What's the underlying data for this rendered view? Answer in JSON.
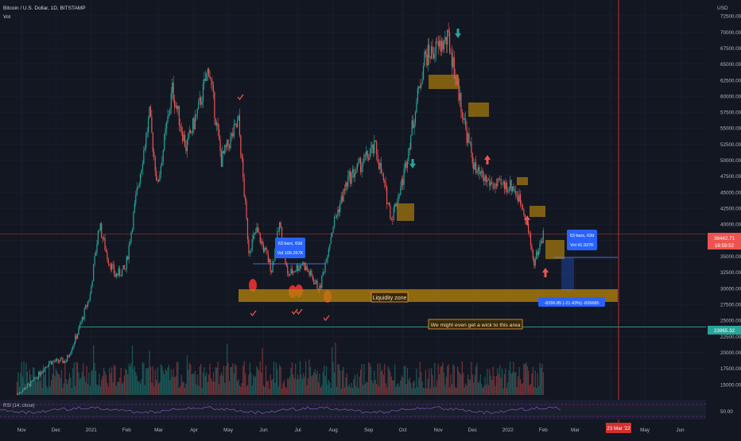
{
  "header": {
    "symbol": "Bitcoin / U.S. Dollar, 1D, BITSTAMP",
    "vol_label": "Vol",
    "currency": "USD"
  },
  "price_axis": {
    "ticks": [
      72500,
      70000,
      67500,
      65000,
      62500,
      60000,
      57500,
      55000,
      52500,
      50000,
      47500,
      45000,
      42500,
      40000,
      37500,
      35000,
      32500,
      30000,
      27500,
      25000,
      22500,
      20000,
      17500,
      15000
    ],
    "tick_labels": [
      "72500.00",
      "70000.00",
      "67500.00",
      "65000.00",
      "62500.00",
      "60000.00",
      "57500.00",
      "55000.00",
      "52500.00",
      "50000.00",
      "47500.00",
      "45000.00",
      "42500.00",
      "40000.00",
      "37500.00",
      "35000.00",
      "32500.00",
      "30000.00",
      "27500.00",
      "25000.00",
      "22500.00",
      "20000.00",
      "17500.00",
      "15000.00"
    ],
    "current_price": "38442.71",
    "countdown": "18:59:52",
    "level_label": "23965.32",
    "rsi_level": "50.00"
  },
  "time_axis": {
    "labels": [
      "Nov",
      "Dec",
      "2021",
      "Feb",
      "Mar",
      "Apr",
      "May",
      "Jun",
      "Jul",
      "Aug",
      "Sep",
      "Oct",
      "Nov",
      "Dec",
      "2022",
      "Feb",
      "Mar",
      "Apr",
      "May",
      "Jun"
    ],
    "marker_label": "23 Mar '22"
  },
  "annotations": {
    "liquidity_zone": "Liquidity zone",
    "wick_note": "We might even get a wick to this area",
    "measure1_bars": "63 bars, 63d",
    "measure1_vol": "Vol 109.267K",
    "measure2_bars": "63 bars, 63d",
    "measure2_vol": "Vol 41.937K",
    "drop_label": "-8296.85 (-21.43%) -826685"
  },
  "rsi_label": "RSI (14, close)",
  "colors": {
    "background": "#131722",
    "up": "#26a69a",
    "down": "#ef5350",
    "zone": "#b8860b",
    "level": "#26a69a",
    "measure": "#2962ff",
    "marker": "#d32f2f",
    "rsi": "#9c27b0",
    "grid": "#1e2230"
  },
  "chart_data": {
    "type": "candlestick",
    "title": "Bitcoin / U.S. Dollar, 1D, BITSTAMP",
    "y_range": [
      13000,
      74000
    ],
    "scale": "linear",
    "grid": true,
    "x": [
      "2020-11",
      "2020-12",
      "2021-01",
      "2021-02",
      "2021-03",
      "2021-04",
      "2021-05",
      "2021-06",
      "2021-07",
      "2021-08",
      "2021-09",
      "2021-10",
      "2021-11",
      "2021-12",
      "2022-01",
      "2022-02"
    ],
    "series": [
      {
        "values": [
          13800,
          19000,
          33000,
          45000,
          57000,
          59000,
          37000,
          35000,
          34000,
          46000,
          44000,
          61000,
          57000,
          47000,
          38000,
          38442
        ]
      }
    ],
    "path_points": [
      [
        "2020-10-28",
        13500
      ],
      [
        "2020-11-10",
        15300
      ],
      [
        "2020-11-25",
        18500
      ],
      [
        "2020-12-10",
        18700
      ],
      [
        "2020-12-20",
        23000
      ],
      [
        "2020-12-31",
        29000
      ],
      [
        "2021-01-08",
        40000
      ],
      [
        "2021-01-15",
        35000
      ],
      [
        "2021-01-22",
        32000
      ],
      [
        "2021-01-31",
        33000
      ],
      [
        "2021-02-10",
        45000
      ],
      [
        "2021-02-21",
        57000
      ],
      [
        "2021-02-28",
        46000
      ],
      [
        "2021-03-13",
        61000
      ],
      [
        "2021-03-25",
        52000
      ],
      [
        "2021-04-05",
        58000
      ],
      [
        "2021-04-14",
        64500
      ],
      [
        "2021-04-25",
        50000
      ],
      [
        "2021-05-10",
        56000
      ],
      [
        "2021-05-19",
        36000
      ],
      [
        "2021-05-26",
        39000
      ],
      [
        "2021-06-08",
        33000
      ],
      [
        "2021-06-15",
        40000
      ],
      [
        "2021-06-22",
        32000
      ],
      [
        "2021-07-05",
        34000
      ],
      [
        "2021-07-20",
        29800
      ],
      [
        "2021-08-01",
        40000
      ],
      [
        "2021-08-14",
        47000
      ],
      [
        "2021-09-07",
        52000
      ],
      [
        "2021-09-21",
        41000
      ],
      [
        "2021-10-01",
        47000
      ],
      [
        "2021-10-20",
        66000
      ],
      [
        "2021-11-10",
        68800
      ],
      [
        "2021-11-26",
        54000
      ],
      [
        "2021-12-04",
        48000
      ],
      [
        "2021-12-20",
        46000
      ],
      [
        "2022-01-05",
        46000
      ],
      [
        "2022-01-15",
        42500
      ],
      [
        "2022-01-24",
        34000
      ],
      [
        "2022-02-01",
        38442
      ]
    ],
    "horizontal_levels": [
      {
        "name": "support",
        "value": 23965.32
      },
      {
        "name": "current",
        "value": 38442.71
      }
    ],
    "zones": [
      {
        "label": "Liquidity zone",
        "from": 28500,
        "to": 30500
      }
    ]
  }
}
